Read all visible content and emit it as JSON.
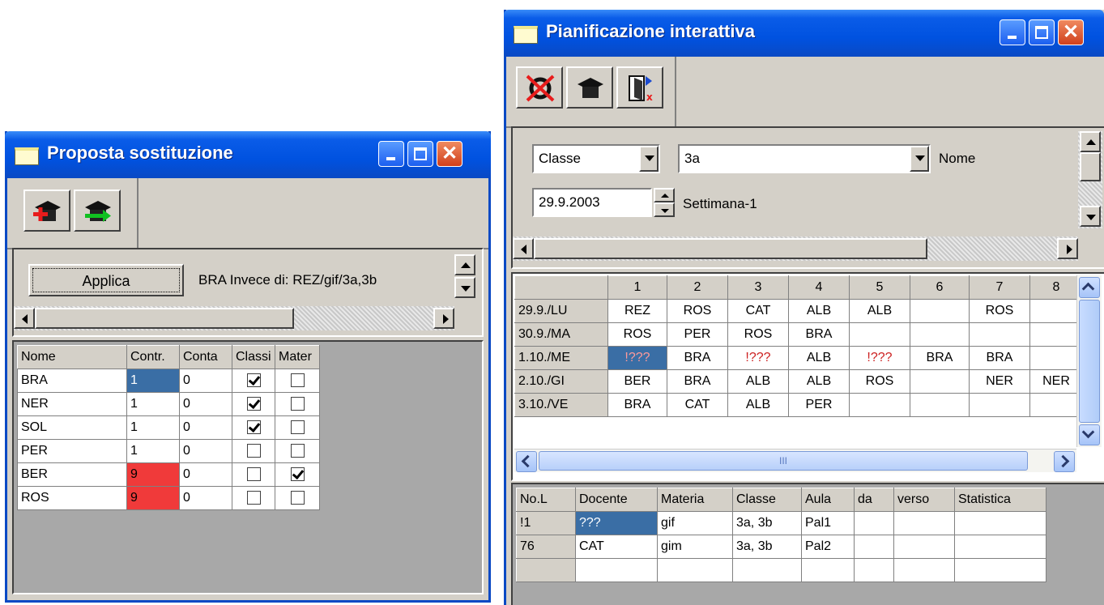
{
  "left_window": {
    "title": "Proposta sostituzione",
    "apply_label": "Applica",
    "info_text": "BRA Invece di: REZ/gif/3a,3b",
    "columns": [
      "Nome",
      "Contr.",
      "Conta",
      "Classi",
      "Mater"
    ],
    "rows": [
      {
        "nome": "BRA",
        "contr": "1",
        "conta": "0",
        "classi": true,
        "mater": false
      },
      {
        "nome": "NER",
        "contr": "1",
        "conta": "0",
        "classi": true,
        "mater": false
      },
      {
        "nome": "SOL",
        "contr": "1",
        "conta": "0",
        "classi": true,
        "mater": false
      },
      {
        "nome": "PER",
        "contr": "1",
        "conta": "0",
        "classi": false,
        "mater": false
      },
      {
        "nome": "BER",
        "contr": "9",
        "conta": "0",
        "classi": false,
        "mater": true
      },
      {
        "nome": "ROS",
        "contr": "9",
        "conta": "0",
        "classi": false,
        "mater": false
      }
    ],
    "colors": {
      "selected": "#3a6ea5",
      "alert": "#f03a3a"
    }
  },
  "right_window": {
    "title": "Pianificazione interattiva",
    "filter_type": "Classe",
    "filter_value": "3a",
    "name_label": "Nome",
    "date_value": "29.9.2003",
    "week_label": "Settimana-1",
    "schedule": {
      "columns": [
        "1",
        "2",
        "3",
        "4",
        "5",
        "6",
        "7",
        "8"
      ],
      "rows": [
        {
          "day": "29.9./LU",
          "cells": [
            "REZ",
            "ROS",
            "CAT",
            "ALB",
            "ALB",
            "",
            "ROS",
            ""
          ]
        },
        {
          "day": "30.9./MA",
          "cells": [
            "ROS",
            "PER",
            "ROS",
            "BRA",
            "",
            "",
            "",
            ""
          ]
        },
        {
          "day": "1.10./ME",
          "cells": [
            "!???",
            "BRA",
            "!???",
            "ALB",
            "!???",
            "BRA",
            "BRA",
            ""
          ]
        },
        {
          "day": "2.10./GI",
          "cells": [
            "BER",
            "BRA",
            "ALB",
            "ALB",
            "ROS",
            "",
            "NER",
            "NER"
          ]
        },
        {
          "day": "3.10./VE",
          "cells": [
            "BRA",
            "CAT",
            "ALB",
            "PER",
            "",
            "",
            "",
            ""
          ]
        }
      ],
      "scroll_thumb_label": "III"
    },
    "lessons": {
      "columns": [
        "No.L",
        "Docente",
        "Materia",
        "Classe",
        "Aula",
        "da",
        "verso",
        "Statistica"
      ],
      "rows": [
        [
          "!1",
          "???",
          "gif",
          "3a, 3b",
          "Pal1",
          "",
          "",
          ""
        ],
        [
          "76",
          "CAT",
          "gim",
          "3a, 3b",
          "Pal2",
          "",
          "",
          ""
        ],
        [
          "",
          "",
          "",
          "",
          "",
          "",
          "",
          ""
        ]
      ]
    }
  }
}
